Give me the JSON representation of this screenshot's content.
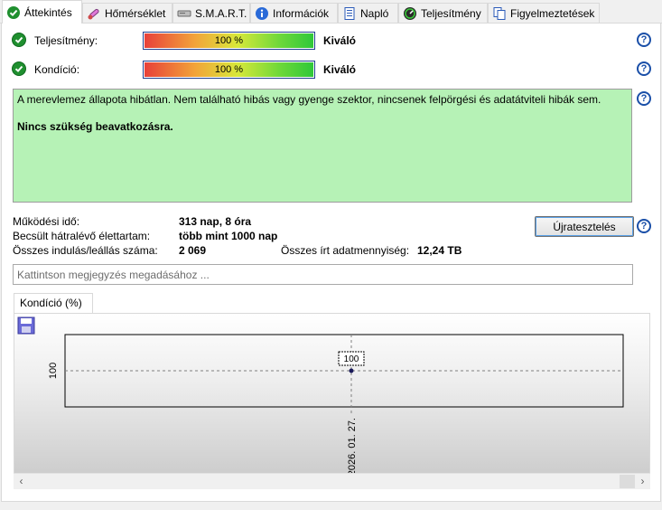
{
  "tabs": [
    {
      "label": "Áttekintés",
      "icon": "check-circle-icon"
    },
    {
      "label": "Hőmérséklet",
      "icon": "thermometer-icon"
    },
    {
      "label": "S.M.A.R.T.",
      "icon": "drive-icon"
    },
    {
      "label": "Információk",
      "icon": "info-icon"
    },
    {
      "label": "Napló",
      "icon": "document-icon"
    },
    {
      "label": "Teljesítmény",
      "icon": "gauge-icon"
    },
    {
      "label": "Figyelmeztetések",
      "icon": "copy-document-icon"
    }
  ],
  "metrics": {
    "performance": {
      "label": "Teljesítmény:",
      "percent_text": "100 %",
      "percent": 100,
      "rating": "Kiváló"
    },
    "health": {
      "label": "Kondíció:",
      "percent_text": "100 %",
      "percent": 100,
      "rating": "Kiváló"
    }
  },
  "status": {
    "message": "A merevlemez állapota hibátlan. Nem található hibás vagy gyenge szektor, nincsenek felpörgési és adatátviteli hibák sem.",
    "action": "Nincs szükség beavatkozásra.",
    "background": "#b6f2b6"
  },
  "stats": {
    "uptime_label": "Működési idő:",
    "uptime_value": "313 nap, 8 óra",
    "remaining_label": "Becsült hátralévő élettartam:",
    "remaining_value": "több mint 1000 nap",
    "starts_label": "Összes indulás/leállás száma:",
    "starts_value": "2 069",
    "written_label": "Összes írt adatmennyiség:",
    "written_value": "12,24 TB"
  },
  "retest_button": "Újratesztelés",
  "note": {
    "placeholder": "Kattintson megjegyzés megadásához ..."
  },
  "chart_tab": "Kondíció  (%)",
  "help_glyph": "?",
  "chart_data": {
    "type": "line",
    "x": [
      "2026. 01. 27."
    ],
    "series": [
      {
        "values": [
          100
        ]
      }
    ],
    "ytick_labels": [
      "100"
    ],
    "point_labels": [
      "100"
    ],
    "grid": true
  },
  "colors": {
    "accent": "#1a4fa8",
    "ok": "#1f8f2f"
  }
}
